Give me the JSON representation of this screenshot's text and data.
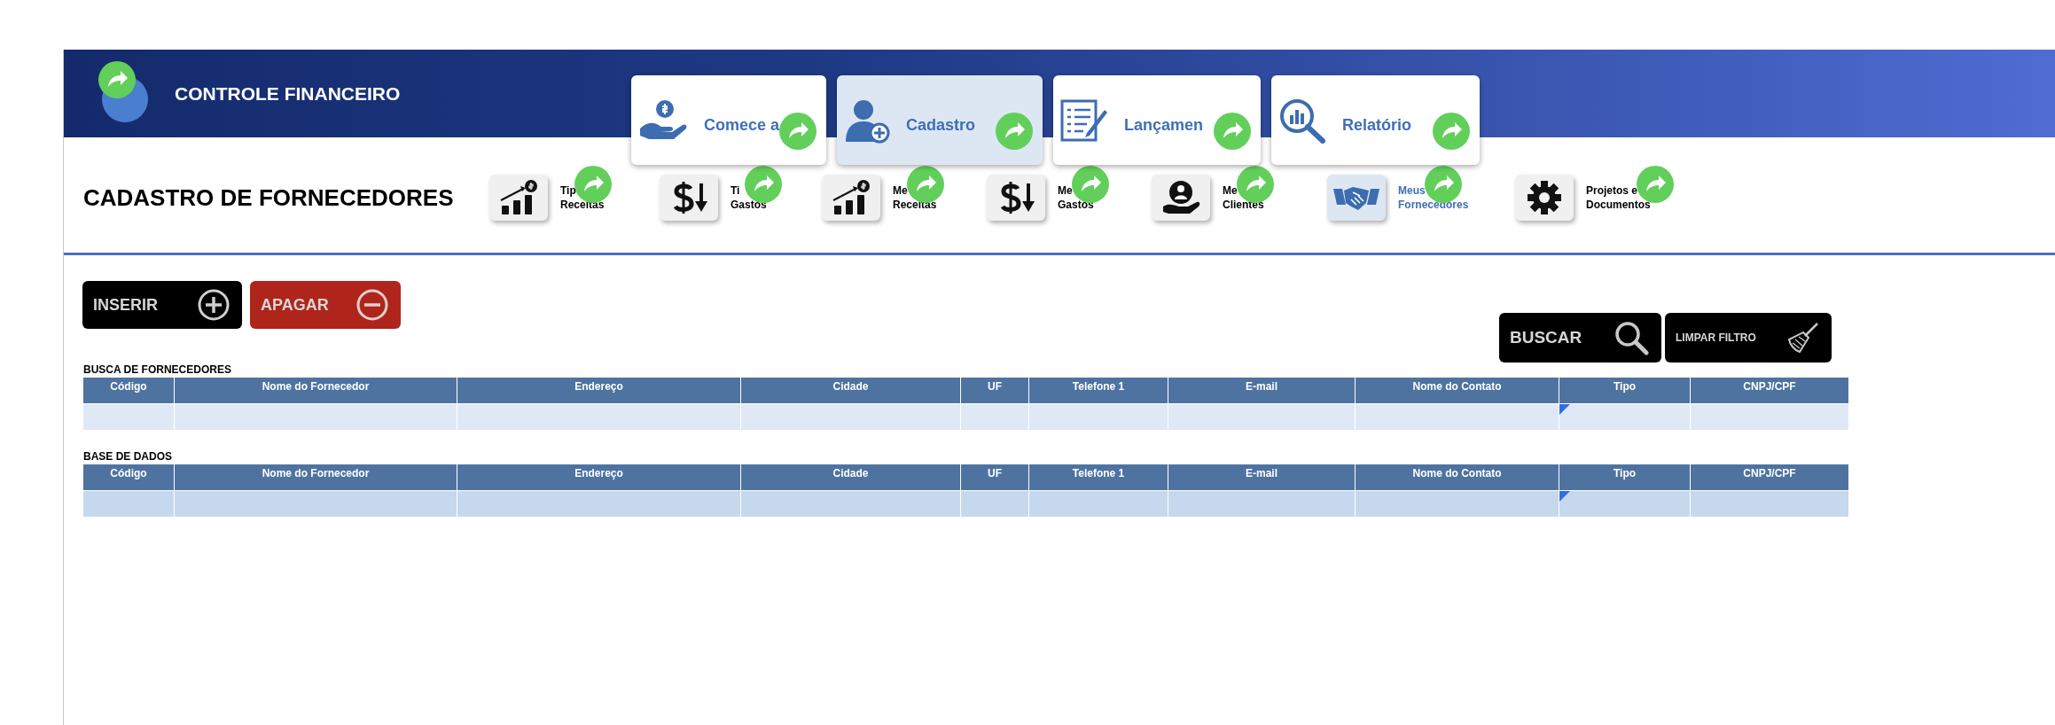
{
  "app": {
    "title": "CONTROLE FINANCEIRO"
  },
  "tabs": [
    {
      "label": "Comece a",
      "kind": "money-hand",
      "selected": false
    },
    {
      "label": "Cadastro",
      "kind": "user-plus",
      "selected": true
    },
    {
      "label": "Lançamen",
      "kind": "form-pen",
      "selected": false
    },
    {
      "label": "Relatório",
      "kind": "chart-lens",
      "selected": false
    }
  ],
  "page_title": "CADASTRO DE FORNECEDORES",
  "nav": [
    {
      "kind": "chart-up",
      "lines": [
        "Tip",
        "Receitas"
      ],
      "selected": false
    },
    {
      "kind": "dollar-down",
      "lines": [
        "Ti",
        "Gastos"
      ],
      "selected": false
    },
    {
      "kind": "chart-up",
      "lines": [
        "Me",
        "Receitas"
      ],
      "selected": false
    },
    {
      "kind": "dollar-down",
      "lines": [
        "Me",
        "Gastos"
      ],
      "selected": false
    },
    {
      "kind": "hand-person",
      "lines": [
        "Me",
        "Clientes"
      ],
      "selected": false
    },
    {
      "kind": "handshake",
      "lines": [
        "Meus",
        "Fornecedores"
      ],
      "selected": true
    },
    {
      "kind": "gear",
      "lines": [
        "Projetos e",
        "Documentos"
      ],
      "selected": false
    }
  ],
  "actions": [
    {
      "label": "INSERIR",
      "kind": "insert"
    },
    {
      "label": "APAGAR",
      "kind": "delete"
    }
  ],
  "filters": [
    {
      "label": "BUSCAR",
      "kind": "search"
    },
    {
      "label": "LIMPAR FILTRO",
      "kind": "clear"
    }
  ],
  "tables": [
    {
      "title": "BUSCA DE FORNECEDORES",
      "kind": "search",
      "columns": [
        "Código",
        "Nome do Fornecedor",
        "Endereço",
        "Cidade",
        "UF",
        "Telefone 1",
        "E-mail",
        "Nome do Contato",
        "Tipo",
        "CNPJ/CPF"
      ]
    },
    {
      "title": "BASE DE DADOS",
      "kind": "base",
      "columns": [
        "Código",
        "Nome do Fornecedor",
        "Endereço",
        "Cidade",
        "UF",
        "Telefone 1",
        "E-mail",
        "Nome do Contato",
        "Tipo",
        "CNPJ/CPF"
      ]
    }
  ]
}
